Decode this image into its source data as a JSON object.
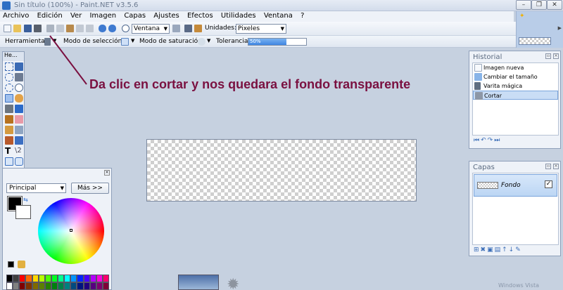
{
  "window": {
    "title": "Sin título (100%) - Paint.NET v3.5.6",
    "min_label": "–",
    "max_label": "❐",
    "close_label": "✕"
  },
  "menu": [
    "Archivo",
    "Edición",
    "Ver",
    "Imagen",
    "Capas",
    "Ajustes",
    "Efectos",
    "Utilidades",
    "Ventana",
    "?"
  ],
  "toolbar": {
    "zoom_select": "Ventana",
    "units_label": "Unidades:",
    "units_select": "Pixeles"
  },
  "tool_options": {
    "tool_label": "Herramienta:",
    "selection_mode_label": "Modo de selección:",
    "saturation_mode_label": "Modo de saturación",
    "tolerance_label": "Tolerancia:",
    "tolerance_value": "50%",
    "tolerance_fraction": 0.66
  },
  "tools_panel": {
    "title": "He..."
  },
  "palette": {
    "mode_select": "Principal",
    "more_button": "Más >>",
    "primary_color": "#000000",
    "secondary_color": "#ffffff",
    "colors_row1": [
      "#000000",
      "#404040",
      "#ff0000",
      "#ff6a00",
      "#ffd800",
      "#b6ff00",
      "#4cff00",
      "#00ff21",
      "#00ff90",
      "#00ffff",
      "#0094ff",
      "#0026ff",
      "#4800ff",
      "#b200ff",
      "#ff00dc",
      "#ff006e"
    ],
    "colors_row2": [
      "#ffffff",
      "#808080",
      "#7f0000",
      "#7f3300",
      "#7f6a00",
      "#5b7f00",
      "#267f00",
      "#007f0e",
      "#007f46",
      "#007f7f",
      "#004a7f",
      "#00137f",
      "#21007f",
      "#57007f",
      "#7f006e",
      "#7f0037"
    ]
  },
  "history": {
    "title": "Historial",
    "items": [
      {
        "label": "Imagen nueva",
        "icon": "new-image-icon",
        "active": false
      },
      {
        "label": "Cambiar el tamaño",
        "icon": "resize-icon",
        "active": false
      },
      {
        "label": "Varita mágica",
        "icon": "magic-wand-icon",
        "active": false
      },
      {
        "label": "Cortar",
        "icon": "scissors-icon",
        "active": true
      }
    ]
  },
  "layers": {
    "title": "Capas",
    "items": [
      {
        "name": "Fondo",
        "visible": true
      }
    ]
  },
  "annotation": {
    "text": "Da clic en cortar y nos quedara el fondo transparente",
    "color": "#7a1040"
  },
  "taskbar": {
    "windows_text": "Windows Vista"
  }
}
